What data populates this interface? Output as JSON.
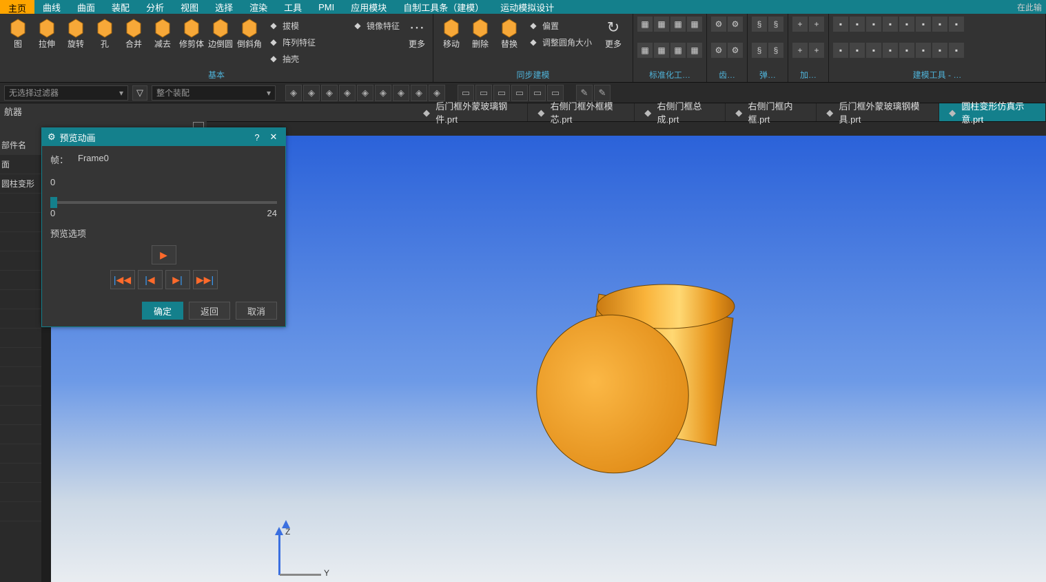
{
  "menubar": {
    "items": [
      "主页",
      "曲线",
      "曲面",
      "装配",
      "分析",
      "视图",
      "选择",
      "渲染",
      "工具",
      "PMI",
      "应用模块",
      "自制工具条（建模）",
      "运动模拟设计"
    ],
    "active_index": 0,
    "search_placeholder": "在此输"
  },
  "ribbon": {
    "group_basic": {
      "label": "基本",
      "large_tools": [
        "图",
        "拉伸",
        "旋转",
        "孔",
        "合并",
        "减去",
        "修剪体",
        "边倒圆",
        "倒斜角"
      ],
      "side_tools": [
        {
          "label": "拔模"
        },
        {
          "label": "阵列特征"
        },
        {
          "label": "抽壳"
        },
        {
          "label": "镜像特征"
        }
      ],
      "more_label": "更多"
    },
    "group_sync": {
      "label": "同步建模",
      "large_tools": [
        "移动",
        "删除",
        "替换"
      ],
      "side_tools": [
        {
          "label": "偏置"
        },
        {
          "label": "调整圆角大小"
        }
      ],
      "more_label": "更多"
    },
    "group_std": {
      "label": "标准化工…"
    },
    "group_gear": {
      "label": "齿…"
    },
    "group_spring": {
      "label": "弹…"
    },
    "group_add": {
      "label": "加…"
    },
    "group_model_tools": {
      "label": "建模工具 - …"
    }
  },
  "filter_bar": {
    "combo1": "无选择过滤器",
    "combo2": "整个装配"
  },
  "doc_tabs": {
    "items": [
      {
        "label": "后门框外蒙玻璃钢件.prt"
      },
      {
        "label": "右侧门框外框模芯.prt"
      },
      {
        "label": "右侧门框总成.prt"
      },
      {
        "label": "右侧门框内框.prt"
      },
      {
        "label": "后门框外蒙玻璃钢模具.prt"
      },
      {
        "label": "圆柱变形仿真示意.prt"
      }
    ],
    "active_index": 5
  },
  "nav": {
    "header": "航器",
    "col_header": "部件名",
    "rows": [
      "面",
      "圆柱变形"
    ]
  },
  "dialog": {
    "title": "预览动画",
    "frame_label": "帧：",
    "frame_value": "Frame0",
    "slider_min": "0",
    "slider_max": "24",
    "slider_top_label": "0",
    "options_label": "预览选项",
    "ok": "确定",
    "back": "返回",
    "cancel": "取消"
  },
  "axis": {
    "z": "Z",
    "y": "Y"
  }
}
